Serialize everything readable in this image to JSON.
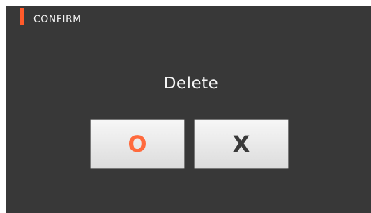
{
  "dialog": {
    "title": "CONFIRM",
    "message": "Delete",
    "accent_color": "#ff5a2a",
    "buttons": {
      "ok_label": "O",
      "cancel_label": "X"
    }
  }
}
